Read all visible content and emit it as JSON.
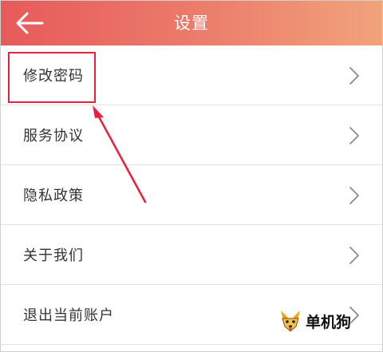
{
  "header": {
    "back_icon": "arrow-left-icon",
    "title": "设置",
    "gradient_colors": [
      "#e75a5a",
      "#f1a37b"
    ]
  },
  "menu": {
    "items": [
      {
        "label": "修改密码",
        "icon": "chevron-right-icon"
      },
      {
        "label": "服务协议",
        "icon": "chevron-right-icon"
      },
      {
        "label": "隐私政策",
        "icon": "chevron-right-icon"
      },
      {
        "label": "关于我们",
        "icon": "chevron-right-icon"
      },
      {
        "label": "退出当前账户",
        "icon": "chevron-right-icon"
      }
    ]
  },
  "annotation": {
    "color": "#e8203a",
    "target": "修改密码"
  },
  "watermark": {
    "text": "单机狗",
    "icon": "dog-logo-icon"
  }
}
